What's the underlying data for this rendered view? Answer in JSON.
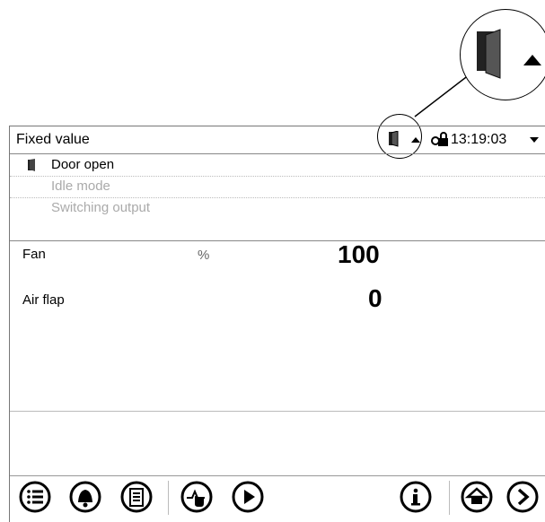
{
  "header": {
    "title": "Fixed value",
    "time": "13:19:03"
  },
  "popup": {
    "items": [
      {
        "label": "Door open",
        "enabled": true,
        "icon": "door-icon"
      },
      {
        "label": "Idle mode",
        "enabled": false
      },
      {
        "label": "Switching output",
        "enabled": false
      }
    ]
  },
  "values": [
    {
      "label": "Fan",
      "unit": "%",
      "value": "100"
    },
    {
      "label": "Air flap",
      "unit": "",
      "value": "0"
    }
  ],
  "footer": {
    "icons": [
      "menu-icon",
      "alarm-icon",
      "notes-icon",
      "touch-icon",
      "play-icon",
      "info-icon",
      "home-icon",
      "next-icon"
    ]
  }
}
